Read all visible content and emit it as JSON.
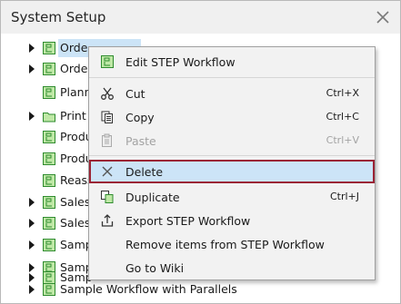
{
  "window": {
    "title": "System Setup"
  },
  "tree": {
    "items": [
      {
        "label": "Orde",
        "icon": "workflow-icon"
      },
      {
        "label": "Orde",
        "icon": "workflow-icon"
      },
      {
        "label": "Plann",
        "icon": "workflow-icon"
      },
      {
        "label": "Print",
        "icon": "folder-icon"
      },
      {
        "label": "Produ",
        "icon": "workflow-icon"
      },
      {
        "label": "Produ",
        "icon": "workflow-icon"
      },
      {
        "label": "Reass",
        "icon": "workflow-icon"
      },
      {
        "label": "Sales",
        "icon": "workflow-icon"
      },
      {
        "label": "Sales",
        "icon": "workflow-icon"
      },
      {
        "label": "Samp",
        "icon": "workflow-icon"
      },
      {
        "label": "Samp",
        "icon": "workflow-icon"
      },
      {
        "label": "Samp",
        "icon": "workflow-icon"
      },
      {
        "label": "Sample Workflow with Parallels",
        "icon": "workflow-icon"
      }
    ]
  },
  "context_menu": {
    "items": [
      {
        "label": "Edit STEP Workflow",
        "shortcut": "",
        "icon": "edit-workflow-icon"
      },
      {
        "label": "Cut",
        "shortcut": "Ctrl+X",
        "icon": "scissors-icon"
      },
      {
        "label": "Copy",
        "shortcut": "Ctrl+C",
        "icon": "copy-icon"
      },
      {
        "label": "Paste",
        "shortcut": "Ctrl+V",
        "icon": "paste-icon",
        "disabled": true
      },
      {
        "label": "Delete",
        "shortcut": "",
        "icon": "delete-x-icon",
        "highlighted": true
      },
      {
        "label": "Duplicate",
        "shortcut": "Ctrl+J",
        "icon": "duplicate-icon"
      },
      {
        "label": "Export STEP Workflow",
        "shortcut": "",
        "icon": "export-icon"
      },
      {
        "label": "Remove items from STEP Workflow",
        "shortcut": "",
        "icon": ""
      },
      {
        "label": "Go to Wiki",
        "shortcut": "",
        "icon": ""
      }
    ]
  },
  "colors": {
    "selection": "#cce4f7",
    "highlight_border": "#9b2335",
    "menu_bg": "#f2f2f2",
    "workflow_icon": "#2e8b2e"
  }
}
